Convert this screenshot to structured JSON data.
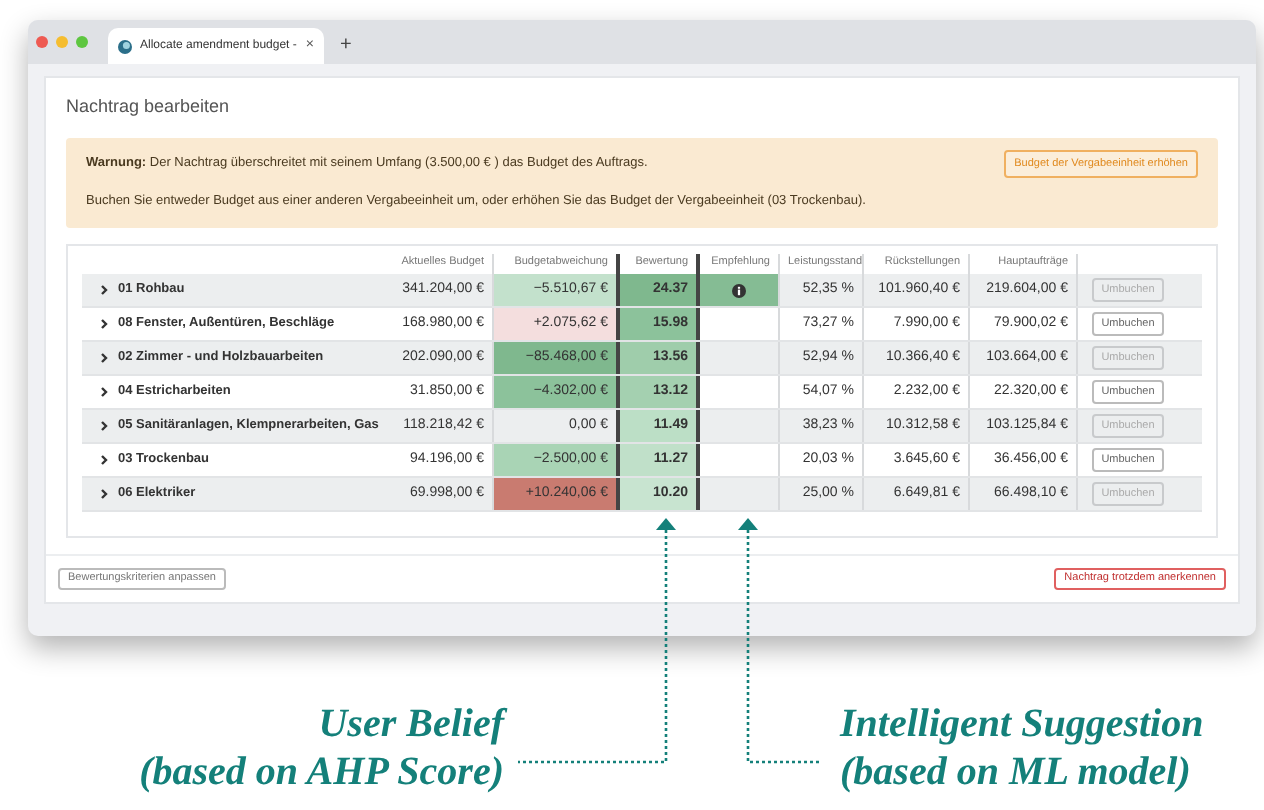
{
  "browser": {
    "tab_title": "Allocate amendment budget - ",
    "tab_close": "×",
    "new_tab": "+"
  },
  "page": {
    "title": "Nachtrag bearbeiten"
  },
  "warning": {
    "label": "Warnung:",
    "text": " Der Nachtrag überschreitet mit seinem Umfang (3.500,00 € ) das Budget des Auftrags.",
    "hint": "Buchen Sie entweder Budget aus einer anderen Vergabeeinheit um, oder erhöhen Sie das Budget der Vergabeeinheit (03 Trockenbau).",
    "button": "Budget der Vergabeeinheit erhöhen"
  },
  "table": {
    "columns": [
      "Aktuelles Budget",
      "Budgetabweichung",
      "Bewertung",
      "Empfehlung",
      "Leistungsstand",
      "Rückstellungen",
      "Hauptaufträge"
    ],
    "rows": [
      {
        "name": "01 Rohbau",
        "budget": "341.204,00 €",
        "deviation": {
          "text": "−5.510,67 €",
          "color": "#c3e1cc"
        },
        "rating": {
          "text": "24.37",
          "color": "#7fb88e"
        },
        "recommended": true,
        "progress": "52,35 %",
        "provisions": "101.960,40 €",
        "main_orders": "219.604,00 €",
        "action": {
          "label": "Umbuchen",
          "disabled": true
        }
      },
      {
        "name": "08 Fenster, Außentüren, Beschläge",
        "budget": "168.980,00 €",
        "deviation": {
          "text": "+2.075,62 €",
          "color": "#f4dede"
        },
        "rating": {
          "text": "15.98",
          "color": "#8cc29b"
        },
        "recommended": false,
        "progress": "73,27 %",
        "provisions": "7.990,00 €",
        "main_orders": "79.900,02 €",
        "action": {
          "label": "Umbuchen",
          "disabled": false
        }
      },
      {
        "name": "02 Zimmer - und Holzbauarbeiten",
        "budget": "202.090,00 €",
        "deviation": {
          "text": "−85.468,00 €",
          "color": "#7fb88e"
        },
        "rating": {
          "text": "13.56",
          "color": "#9fcdab"
        },
        "recommended": false,
        "progress": "52,94 %",
        "provisions": "10.366,40 €",
        "main_orders": "103.664,00 €",
        "action": {
          "label": "Umbuchen",
          "disabled": true
        }
      },
      {
        "name": "04 Estricharbeiten",
        "budget": "31.850,00 €",
        "deviation": {
          "text": "−4.302,00 €",
          "color": "#8cc29b"
        },
        "rating": {
          "text": "13.12",
          "color": "#a4d0b0"
        },
        "recommended": false,
        "progress": "54,07 %",
        "provisions": "2.232,00 €",
        "main_orders": "22.320,00 €",
        "action": {
          "label": "Umbuchen",
          "disabled": false
        }
      },
      {
        "name": "05 Sanitäranlagen, Klempnerarbeiten, Gas",
        "budget": "118.218,42 €",
        "deviation": {
          "text": "0,00 €",
          "color": "#eceeef"
        },
        "rating": {
          "text": "11.49",
          "color": "#bcdfc6"
        },
        "recommended": false,
        "progress": "38,23 %",
        "provisions": "10.312,58 €",
        "main_orders": "103.125,84 €",
        "action": {
          "label": "Umbuchen",
          "disabled": true
        }
      },
      {
        "name": "03 Trockenbau",
        "budget": "94.196,00 €",
        "deviation": {
          "text": "−2.500,00 €",
          "color": "#a9d4b5"
        },
        "rating": {
          "text": "11.27",
          "color": "#c0e0c9"
        },
        "recommended": false,
        "progress": "20,03 %",
        "provisions": "3.645,60 €",
        "main_orders": "36.456,00 €",
        "action": {
          "label": "Umbuchen",
          "disabled": false
        }
      },
      {
        "name": "06 Elektriker",
        "budget": "69.998,00 €",
        "deviation": {
          "text": "+10.240,06 €",
          "color": "#c97b70"
        },
        "rating": {
          "text": "10.20",
          "color": "#c8e4d0"
        },
        "recommended": false,
        "progress": "25,00 %",
        "provisions": "6.649,81 €",
        "main_orders": "66.498,10 €",
        "action": {
          "label": "Umbuchen",
          "disabled": true
        }
      }
    ]
  },
  "footer": {
    "left_button": "Bewertungskriterien anpassen",
    "right_button": "Nachtrag trotzdem anerkennen"
  },
  "annotations": [
    {
      "title": "User Belief",
      "subtitle": "(based on AHP Score)"
    },
    {
      "title": "Intelligent Suggestion",
      "subtitle": "(based on ML model)"
    }
  ]
}
